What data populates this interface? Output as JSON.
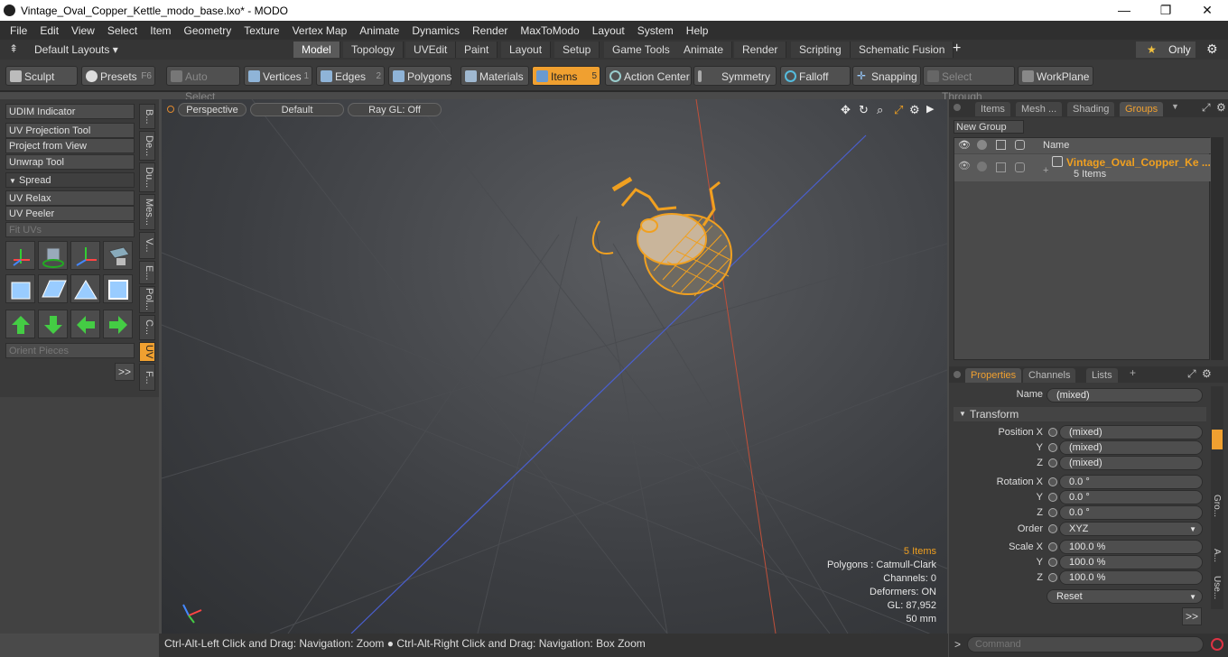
{
  "window": {
    "title": "Vintage_Oval_Copper_Kettle_modo_base.lxo* - MODO",
    "min": "—",
    "max": "❐",
    "close": "✕"
  },
  "menu": [
    "File",
    "Edit",
    "View",
    "Select",
    "Item",
    "Geometry",
    "Texture",
    "Vertex Map",
    "Animate",
    "Dynamics",
    "Render",
    "MaxToModo",
    "Layout",
    "System",
    "Help"
  ],
  "layouts": {
    "default_label": "Default Layouts ▾",
    "tabs": [
      "Model",
      "Topology",
      "UVEdit",
      "Paint",
      "Layout",
      "Setup",
      "Game Tools",
      "Animate",
      "Render",
      "Scripting",
      "Schematic Fusion"
    ],
    "active": "Model",
    "plus": "+",
    "only": "Only",
    "star": "★",
    "gear": "⚙"
  },
  "toolbar": {
    "sculpt": "Sculpt",
    "presets": "Presets",
    "presets_key": "F6",
    "auto_select": "Auto Select",
    "vertices": "Vertices",
    "vertices_key": "1",
    "edges": "Edges",
    "edges_key": "2",
    "polygons": "Polygons",
    "materials": "Materials",
    "items": "Items",
    "items_key": "5",
    "action_center": "Action Center",
    "symmetry": "Symmetry",
    "falloff": "Falloff",
    "snapping": "Snapping",
    "select_through": "Select Through",
    "workplane": "WorkPlane"
  },
  "left": {
    "buttons": [
      "UDIM Indicator",
      "UV Projection Tool",
      "Project from View",
      "Unwrap Tool"
    ],
    "spread": "Spread",
    "buttons2": [
      "UV Relax",
      "UV Peeler",
      "Fit UVs"
    ],
    "orient": "Orient Pieces",
    "more": ">>",
    "vtabs": [
      "B...",
      "De...",
      "Du...",
      "Mes...",
      "V...",
      "E...",
      "Pol...",
      "C...",
      "UV",
      "F..."
    ]
  },
  "viewport": {
    "perspective": "Perspective",
    "default": "Default",
    "raygl": "Ray GL: Off",
    "items": "5 Items",
    "polygons": "Polygons : Catmull-Clark",
    "channels": "Channels: 0",
    "deformers": "Deformers: ON",
    "gl": "GL: 87,952",
    "mm": "50 mm"
  },
  "status": "Ctrl-Alt-Left Click and Drag: Navigation: Zoom ● Ctrl-Alt-Right Click and Drag: Navigation: Box Zoom",
  "groups": {
    "tabs": [
      "Items",
      "Mesh ...",
      "Shading",
      "Groups"
    ],
    "new_group": "New Group",
    "col_name": "Name",
    "item_name": "Vintage_Oval_Copper_Ke ...",
    "item_count": "5 Items"
  },
  "properties": {
    "tabs": [
      "Properties",
      "Channels",
      "Lists"
    ],
    "name_label": "Name",
    "name_value": "(mixed)",
    "transform": "Transform",
    "position_label": "Position X",
    "px": "(mixed)",
    "py": "(mixed)",
    "pz": "(mixed)",
    "rotation_label": "Rotation X",
    "rx": "0.0 °",
    "ry": "0.0 °",
    "rz": "0.0 °",
    "order_label": "Order",
    "order": "XYZ",
    "scale_label": "Scale X",
    "sx": "100.0 %",
    "sy": "100.0 %",
    "sz": "100.0 %",
    "y": "Y",
    "z": "Z",
    "reset": "Reset",
    "more": ">>",
    "side": [
      "Gro...",
      "A...",
      "Use..."
    ]
  },
  "command": {
    "placeholder": "Command",
    "prompt": ">"
  }
}
